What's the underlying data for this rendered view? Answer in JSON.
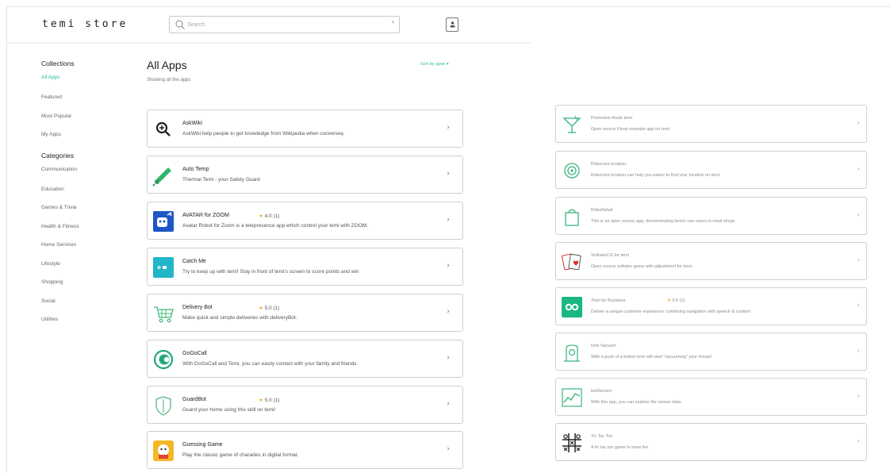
{
  "header": {
    "logo": "temi store",
    "search_placeholder": "Search"
  },
  "sidebar": {
    "collections_title": "Collections",
    "collections": [
      {
        "label": "All Apps",
        "active": true
      },
      {
        "label": "Featured"
      },
      {
        "label": "Most Popular"
      },
      {
        "label": "My Apps"
      }
    ],
    "categories_title": "Categories",
    "categories": [
      {
        "label": "Communication"
      },
      {
        "label": "Education"
      },
      {
        "label": "Games & Trivia"
      },
      {
        "label": "Health & Fitness"
      },
      {
        "label": "Home Services"
      },
      {
        "label": "Lifestyle"
      },
      {
        "label": "Shopping"
      },
      {
        "label": "Social"
      },
      {
        "label": "Utilities"
      }
    ]
  },
  "main": {
    "title": "All Apps",
    "subtitle": "Showing all the apps",
    "sort_label": "Sort by upon ▾"
  },
  "apps_left": [
    {
      "name": "AskWiki",
      "rating": "",
      "description": "AskWiki help people to get knowledge from Wikipedia when conversey.",
      "icon": "search-plus-icon"
    },
    {
      "name": "Auto Temp",
      "rating": "",
      "description": "Thermal Temi - your Safety Guard",
      "icon": "thermometer-icon"
    },
    {
      "name": "AVATAR for ZOOM",
      "rating": "4.0 (1)",
      "description": "Avatar Robot for Zoom is a telepresence app which control your temi with ZOOM.",
      "icon": "avatar-zoom-icon"
    },
    {
      "name": "Catch Me",
      "rating": "",
      "description": "Try to keep up with temi! Stay in front of temi's screen to score points and win",
      "icon": "catch-me-icon"
    },
    {
      "name": "Delivery Bot",
      "rating": "5.0 (1)",
      "description": "Make quick and simple deliveries with deliveryBot.",
      "icon": "delivery-cart-icon"
    },
    {
      "name": "GoGoCall",
      "rating": "",
      "description": "With GoGoCall and Temi, you can easily contact with your family and friends",
      "icon": "gogocall-icon"
    },
    {
      "name": "GuardBot",
      "rating": "5.0 (1)",
      "description": "Guard your home using this skill on temi!",
      "icon": "shield-icon"
    },
    {
      "name": "Guessing Game",
      "rating": "",
      "description": "Play the classic game of charades in digital format.",
      "icon": "guessing-game-icon"
    }
  ],
  "apps_right": [
    {
      "name": "Promotion Kiosk temi",
      "rating": "",
      "description": "Open source Kiosk example app for temi",
      "icon": "cocktail-icon"
    },
    {
      "name": "Robocom location",
      "rating": "",
      "description": "Robocom location can help you easier to find your location on temi",
      "icon": "location-target-icon"
    },
    {
      "name": "RoboRetail",
      "rating": "",
      "description": "This is an open source app, demonstrating temi's use cases in retail shops",
      "icon": "shopping-bag-icon"
    },
    {
      "name": "SolitaireCG for temi",
      "rating": "",
      "description": "Open source solitaire game with adjustment for temi.",
      "icon": "playing-cards-icon"
    },
    {
      "name": "Temi for Business",
      "rating": "5.0 (1)",
      "description": "Deliver a unique customer experience combining navigation with speech & content",
      "icon": "temi-business-icon"
    },
    {
      "name": "temi Vacuum",
      "rating": "",
      "description": "With a push of a button temi will start \"vacuuming\" your house!",
      "icon": "vacuum-icon"
    },
    {
      "name": "testSensor",
      "rating": "",
      "description": "With this app, you can explore the sensor data.",
      "icon": "sensor-chart-icon"
    },
    {
      "name": "Tic Tac Toe",
      "rating": "",
      "description": "A tic tac toe game to have fun",
      "icon": "tic-tac-toe-icon"
    }
  ],
  "colors": {
    "accent": "#2eb8a4",
    "star": "#e8b528",
    "avatar_blue": "#1f56c6",
    "catch_teal": "#21b5c8",
    "business_green": "#19b784"
  }
}
